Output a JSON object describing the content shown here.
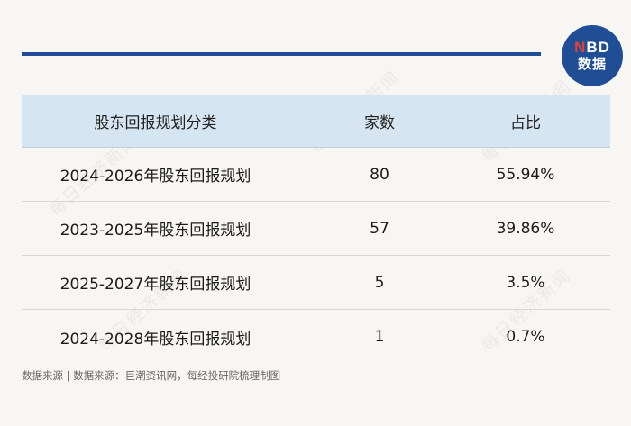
{
  "logo": {
    "top_n": "N",
    "top_rest": "BD",
    "bottom": "数据"
  },
  "watermark_text": "每日经济新闻",
  "table": {
    "headers": [
      "股东回报规划分类",
      "家数",
      "占比"
    ],
    "rows": [
      [
        "2024-2026年股东回报规划",
        "80",
        "55.94%"
      ],
      [
        "2023-2025年股东回报规划",
        "57",
        "39.86%"
      ],
      [
        "2025-2027年股东回报规划",
        "5",
        "3.5%"
      ],
      [
        "2024-2028年股东回报规划",
        "1",
        "0.7%"
      ]
    ]
  },
  "source": "数据来源 | 数据来源：巨潮资讯网，每经投研院梳理制图",
  "colors": {
    "accent_blue": "#1f4e97",
    "header_bg": "#d6e5f2",
    "logo_red": "#e64032"
  }
}
